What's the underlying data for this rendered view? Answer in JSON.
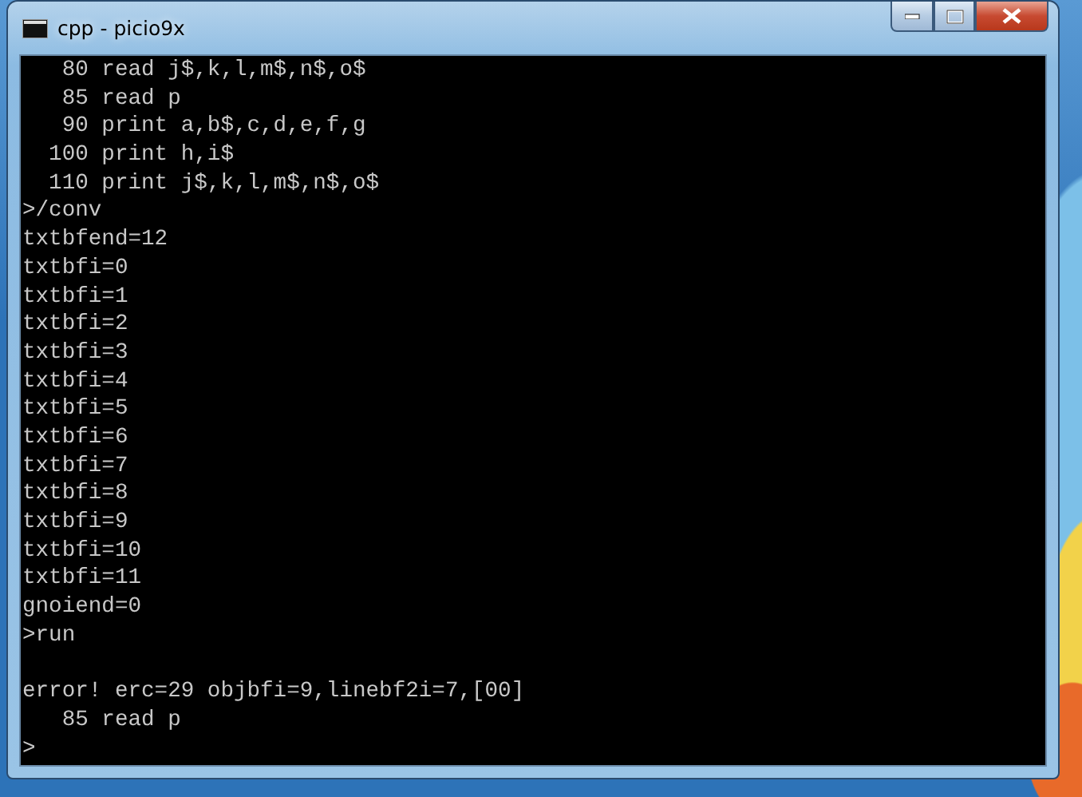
{
  "window": {
    "title": "cpp - picio9x"
  },
  "console": {
    "lines": [
      {
        "kind": "text",
        "text": "   80 read j$,k,l,m$,n$,o$"
      },
      {
        "kind": "text",
        "text": "   85 read p"
      },
      {
        "kind": "text",
        "text": "   90 print a,b$,c,d,e,f,g"
      },
      {
        "kind": "text",
        "text": "  100 print h,i$"
      },
      {
        "kind": "text",
        "text": "  110 print j$,k,l,m$,n$,o$"
      },
      {
        "kind": "text",
        "text": ">/conv"
      },
      {
        "kind": "text",
        "text": "txtbfend=12"
      },
      {
        "kind": "text",
        "text": "txtbfi=0"
      },
      {
        "kind": "text",
        "text": "txtbfi=1"
      },
      {
        "kind": "text",
        "text": "txtbfi=2"
      },
      {
        "kind": "text",
        "text": "txtbfi=3"
      },
      {
        "kind": "text",
        "text": "txtbfi=4"
      },
      {
        "kind": "text",
        "text": "txtbfi=5"
      },
      {
        "kind": "text",
        "text": "txtbfi=6"
      },
      {
        "kind": "text",
        "text": "txtbfi=7"
      },
      {
        "kind": "text",
        "text": "txtbfi=8"
      },
      {
        "kind": "text",
        "text": "txtbfi=9"
      },
      {
        "kind": "text",
        "text": "txtbfi=10"
      },
      {
        "kind": "text",
        "text": "txtbfi=11"
      },
      {
        "kind": "text",
        "text": "gnoiend=0"
      },
      {
        "kind": "text",
        "text": ">run"
      },
      {
        "kind": "blank"
      },
      {
        "kind": "text",
        "text": "error! erc=29 objbfi=9,linebf2i=7,[00]"
      },
      {
        "kind": "text",
        "text": "   85 read p"
      },
      {
        "kind": "text",
        "text": ">"
      }
    ]
  }
}
